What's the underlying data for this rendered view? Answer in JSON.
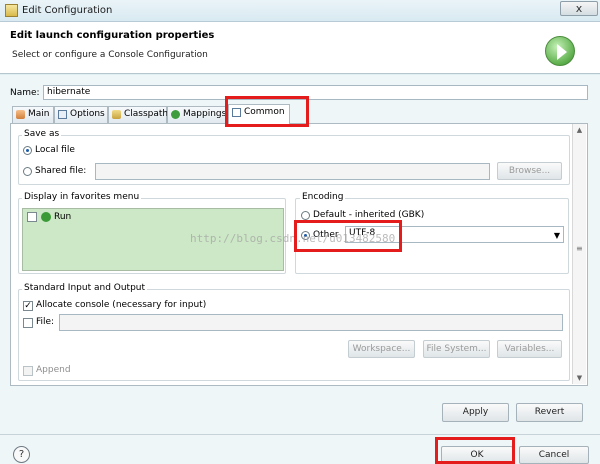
{
  "window": {
    "title": "Edit Configuration",
    "close_glyph": "x"
  },
  "header": {
    "title": "Edit launch configuration properties",
    "subtitle": "Select or configure a Console Configuration",
    "run_icon": "run-icon"
  },
  "name_field": {
    "label": "Name:",
    "value": "hibernate"
  },
  "tabs": [
    {
      "label": "Main",
      "icon": "main-tab-icon"
    },
    {
      "label": "Options",
      "icon": "options-tab-icon"
    },
    {
      "label": "Classpath",
      "icon": "classpath-tab-icon"
    },
    {
      "label": "Mappings",
      "icon": "mappings-tab-icon"
    },
    {
      "label": "Common",
      "icon": "common-tab-icon"
    }
  ],
  "save_as": {
    "title": "Save as",
    "local_label": "Local file",
    "shared_label": "Shared file:",
    "shared_value": "",
    "browse_label": "Browse..."
  },
  "favorites": {
    "title": "Display in favorites menu",
    "items": [
      {
        "label": "Run",
        "icon": "run-small-icon"
      }
    ]
  },
  "encoding": {
    "title": "Encoding",
    "default_label": "Default - inherited (GBK)",
    "other_label": "Other",
    "other_value": "UTF-8"
  },
  "io": {
    "title": "Standard Input and Output",
    "allocate_label": "Allocate console (necessary for input)",
    "file_label": "File:",
    "file_value": "",
    "workspace_label": "Workspace...",
    "filesystem_label": "File System...",
    "variables_label": "Variables...",
    "append_label": "Append"
  },
  "buttons": {
    "apply": "Apply",
    "revert": "Revert",
    "ok": "OK",
    "cancel": "Cancel"
  },
  "help_glyph": "?",
  "watermark": "http://blog.csdn.net/u013482580",
  "colors": {
    "highlight_red": "#e41c1c",
    "favorites_bg": "#cde8c6",
    "selected_blue": "#1e5ba7"
  }
}
